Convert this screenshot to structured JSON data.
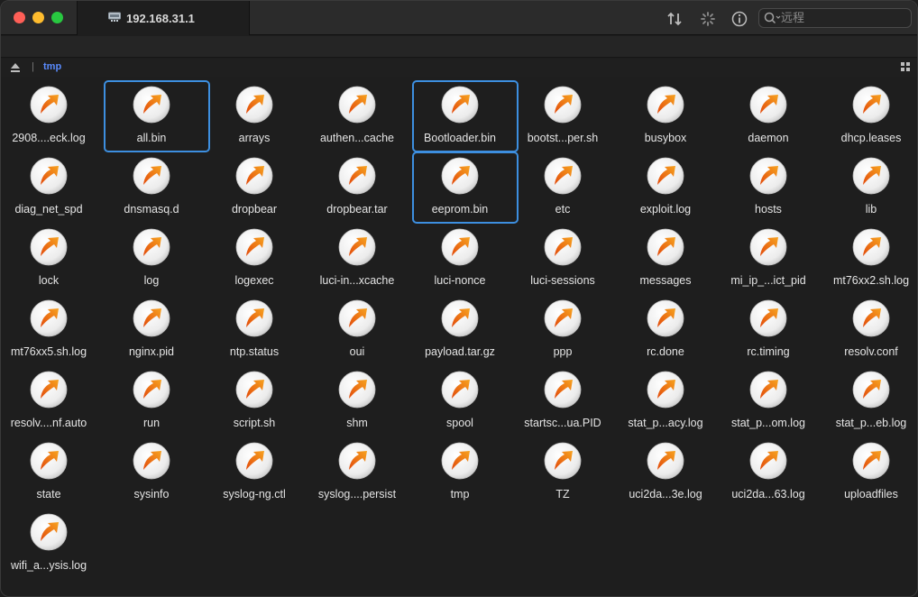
{
  "window": {
    "tab_title": "192.168.31.1",
    "search_placeholder": "远程"
  },
  "pathbar": {
    "current_folder": "tmp"
  },
  "icons": {
    "file": "transmit-file-icon",
    "accent": "#f08a1c",
    "selection_color": "#3d8fe0"
  },
  "files": [
    {
      "name": "2908....eck.log",
      "selected": false
    },
    {
      "name": "all.bin",
      "selected": true
    },
    {
      "name": "arrays",
      "selected": false
    },
    {
      "name": "authen...cache",
      "selected": false
    },
    {
      "name": "Bootloader.bin",
      "selected": true
    },
    {
      "name": "bootst...per.sh",
      "selected": false
    },
    {
      "name": "busybox",
      "selected": false
    },
    {
      "name": "daemon",
      "selected": false
    },
    {
      "name": "dhcp.leases",
      "selected": false
    },
    {
      "name": "diag_net_spd",
      "selected": false
    },
    {
      "name": "dnsmasq.d",
      "selected": false
    },
    {
      "name": "dropbear",
      "selected": false
    },
    {
      "name": "dropbear.tar",
      "selected": false
    },
    {
      "name": "eeprom.bin",
      "selected": true
    },
    {
      "name": "etc",
      "selected": false
    },
    {
      "name": "exploit.log",
      "selected": false
    },
    {
      "name": "hosts",
      "selected": false
    },
    {
      "name": "lib",
      "selected": false
    },
    {
      "name": "lock",
      "selected": false
    },
    {
      "name": "log",
      "selected": false
    },
    {
      "name": "logexec",
      "selected": false
    },
    {
      "name": "luci-in...xcache",
      "selected": false
    },
    {
      "name": "luci-nonce",
      "selected": false
    },
    {
      "name": "luci-sessions",
      "selected": false
    },
    {
      "name": "messages",
      "selected": false
    },
    {
      "name": "mi_ip_...ict_pid",
      "selected": false
    },
    {
      "name": "mt76xx2.sh.log",
      "selected": false
    },
    {
      "name": "mt76xx5.sh.log",
      "selected": false
    },
    {
      "name": "nginx.pid",
      "selected": false
    },
    {
      "name": "ntp.status",
      "selected": false
    },
    {
      "name": "oui",
      "selected": false
    },
    {
      "name": "payload.tar.gz",
      "selected": false
    },
    {
      "name": "ppp",
      "selected": false
    },
    {
      "name": "rc.done",
      "selected": false
    },
    {
      "name": "rc.timing",
      "selected": false
    },
    {
      "name": "resolv.conf",
      "selected": false
    },
    {
      "name": "resolv....nf.auto",
      "selected": false
    },
    {
      "name": "run",
      "selected": false
    },
    {
      "name": "script.sh",
      "selected": false
    },
    {
      "name": "shm",
      "selected": false
    },
    {
      "name": "spool",
      "selected": false
    },
    {
      "name": "startsc...ua.PID",
      "selected": false
    },
    {
      "name": "stat_p...acy.log",
      "selected": false
    },
    {
      "name": "stat_p...om.log",
      "selected": false
    },
    {
      "name": "stat_p...eb.log",
      "selected": false
    },
    {
      "name": "state",
      "selected": false
    },
    {
      "name": "sysinfo",
      "selected": false
    },
    {
      "name": "syslog-ng.ctl",
      "selected": false
    },
    {
      "name": "syslog....persist",
      "selected": false
    },
    {
      "name": "tmp",
      "selected": false
    },
    {
      "name": "TZ",
      "selected": false
    },
    {
      "name": "uci2da...3e.log",
      "selected": false
    },
    {
      "name": "uci2da...63.log",
      "selected": false
    },
    {
      "name": "uploadfiles",
      "selected": false
    },
    {
      "name": "wifi_a...ysis.log",
      "selected": false
    }
  ]
}
